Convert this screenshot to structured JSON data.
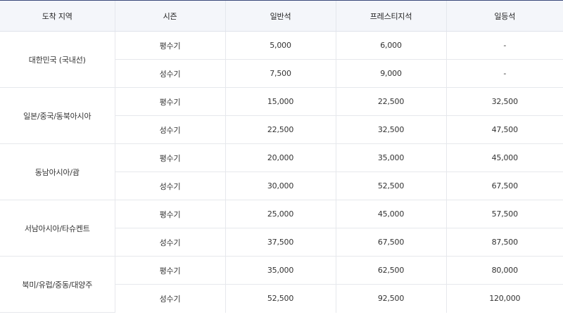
{
  "headers": [
    "도착 지역",
    "시즌",
    "일반석",
    "프레스티지석",
    "일등석"
  ],
  "rows": [
    {
      "region": "대한민국 (국내선)",
      "seasons": [
        {
          "season": "평수기",
          "economy": "5,000",
          "prestige": "6,000",
          "first": "-"
        },
        {
          "season": "성수기",
          "economy": "7,500",
          "prestige": "9,000",
          "first": "-"
        }
      ]
    },
    {
      "region": "일본/중국/동북아시아",
      "seasons": [
        {
          "season": "평수기",
          "economy": "15,000",
          "prestige": "22,500",
          "first": "32,500"
        },
        {
          "season": "성수기",
          "economy": "22,500",
          "prestige": "32,500",
          "first": "47,500"
        }
      ]
    },
    {
      "region": "동남아시아/괌",
      "seasons": [
        {
          "season": "평수기",
          "economy": "20,000",
          "prestige": "35,000",
          "first": "45,000"
        },
        {
          "season": "성수기",
          "economy": "30,000",
          "prestige": "52,500",
          "first": "67,500"
        }
      ]
    },
    {
      "region": "서남아시아/타슈켄트",
      "seasons": [
        {
          "season": "평수기",
          "economy": "25,000",
          "prestige": "45,000",
          "first": "57,500"
        },
        {
          "season": "성수기",
          "economy": "37,500",
          "prestige": "67,500",
          "first": "87,500"
        }
      ]
    },
    {
      "region": "북미/유럽/중동/대양주",
      "seasons": [
        {
          "season": "평수기",
          "economy": "35,000",
          "prestige": "62,500",
          "first": "80,000"
        },
        {
          "season": "성수기",
          "economy": "52,500",
          "prestige": "92,500",
          "first": "120,000"
        }
      ]
    }
  ]
}
